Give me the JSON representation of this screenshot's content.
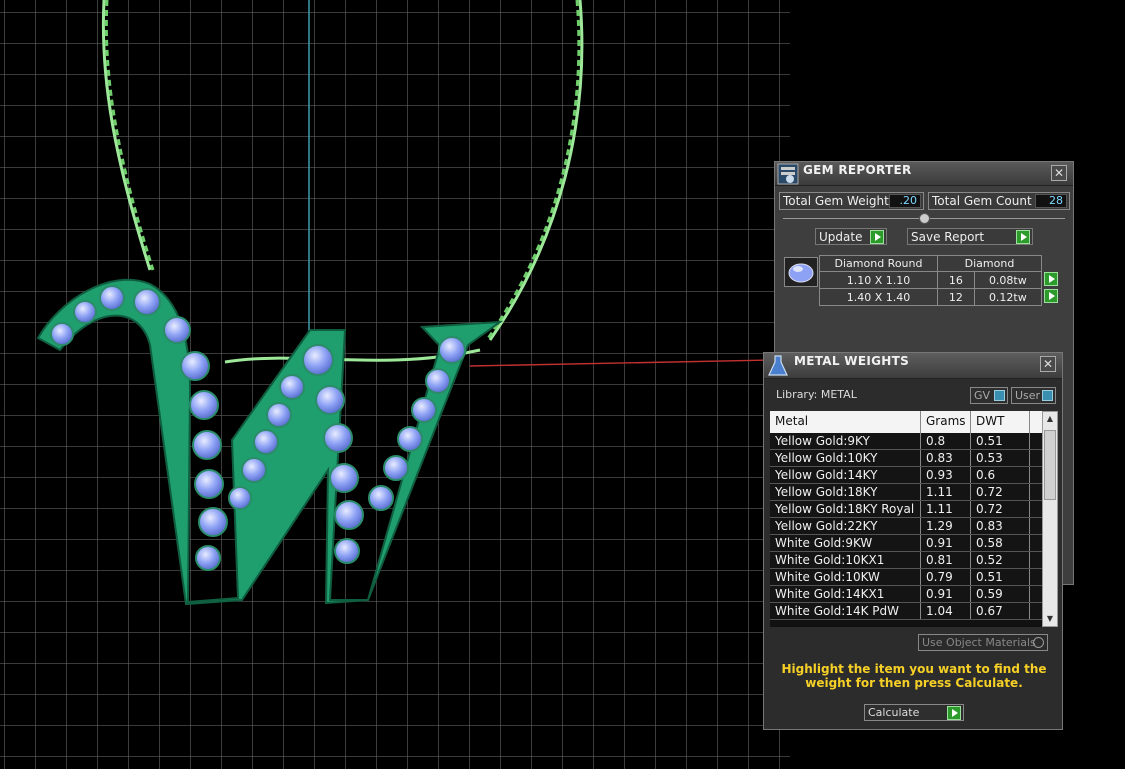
{
  "gem_reporter": {
    "title": "GEM REPORTER",
    "total_gem_weight_label": "Total Gem Weight",
    "total_gem_weight": ".20",
    "total_gem_count_label": "Total Gem Count",
    "total_gem_count": "28",
    "update_label": "Update",
    "save_report_label": "Save Report",
    "table": {
      "col1": "Diamond Round",
      "col2": "Diamond",
      "rows": [
        {
          "size": "1.10 X 1.10",
          "count": "16",
          "weight": "0.08tw"
        },
        {
          "size": "1.40 X 1.40",
          "count": "12",
          "weight": "0.12tw"
        }
      ]
    }
  },
  "metal_weights": {
    "title": "METAL WEIGHTS",
    "library_label": "Library: METAL",
    "gv_label": "GV",
    "user_label": "User",
    "columns": [
      "Metal",
      "Grams",
      "DWT"
    ],
    "rows": [
      [
        "Yellow Gold:9KY",
        "0.8",
        "0.51"
      ],
      [
        "Yellow Gold:10KY",
        "0.83",
        "0.53"
      ],
      [
        "Yellow Gold:14KY",
        "0.93",
        "0.6"
      ],
      [
        "Yellow Gold:18KY",
        "1.11",
        "0.72"
      ],
      [
        "Yellow Gold:18KY Royal",
        "1.11",
        "0.72"
      ],
      [
        "Yellow Gold:22KY",
        "1.29",
        "0.83"
      ],
      [
        "White Gold:9KW",
        "0.91",
        "0.58"
      ],
      [
        "White Gold:10KX1",
        "0.81",
        "0.52"
      ],
      [
        "White Gold:10KW",
        "0.79",
        "0.51"
      ],
      [
        "White Gold:14KX1",
        "0.91",
        "0.59"
      ],
      [
        "White Gold:14K PdW",
        "1.04",
        "0.67"
      ]
    ],
    "use_object_materials_label": "Use Object Materials",
    "hint": "Highlight the item you want to find the weight for then press Calculate.",
    "calculate_label": "Calculate"
  },
  "colors": {
    "grid_line": "#6a6a6a",
    "chain": "#9ee89a",
    "pendant": "#1f9e6e",
    "gem": "#a9b7ff",
    "hint_text": "#f6d026"
  }
}
